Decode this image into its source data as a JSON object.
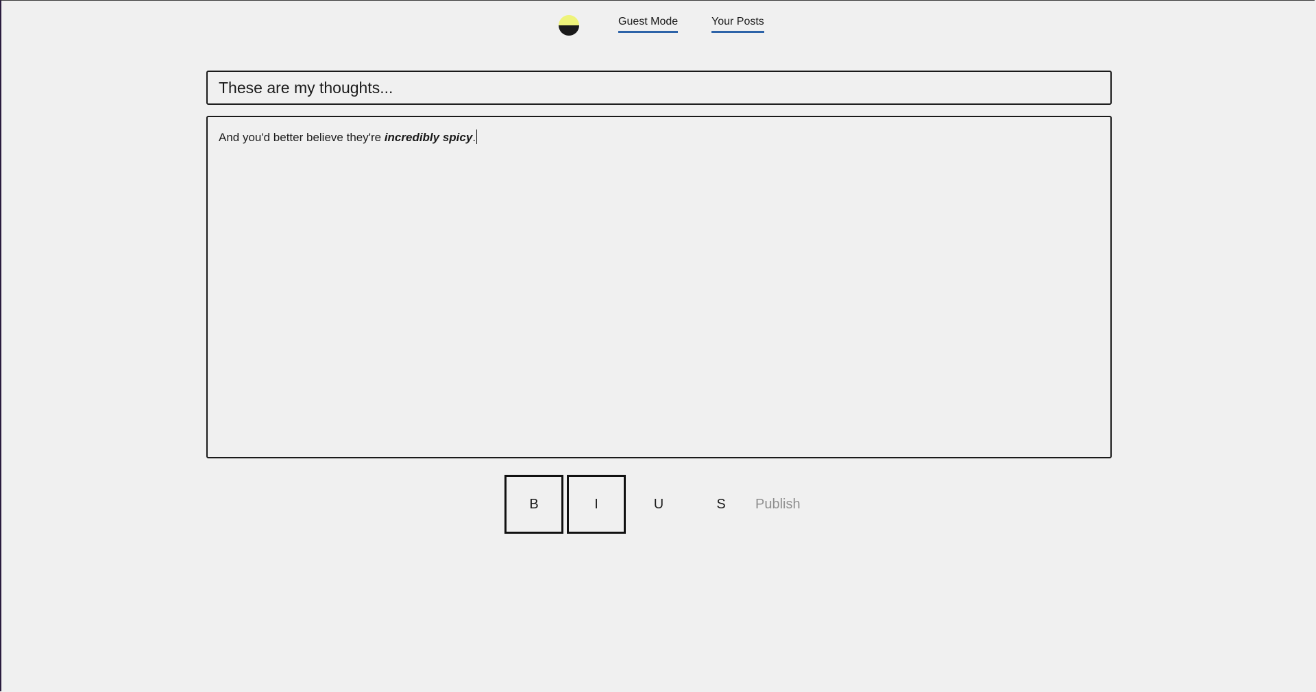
{
  "nav": {
    "theme_toggle_icon": "half-moon-theme-icon",
    "colors": {
      "toggle_light": "#eef37a",
      "toggle_dark": "#1a1a1a",
      "link_underline": "#2d63a8"
    },
    "links": [
      {
        "label": "Guest Mode"
      },
      {
        "label": "Your Posts"
      }
    ]
  },
  "editor": {
    "title_value": "These are my thoughts...",
    "body_text_plain": "And you'd better believe they're ",
    "body_text_emphasis": "incredibly spicy",
    "body_text_end": "."
  },
  "toolbar": {
    "bold_label": "B",
    "italic_label": "I",
    "underline_label": "U",
    "strike_label": "S",
    "publish_label": "Publish",
    "active": [
      "bold",
      "italic"
    ]
  }
}
